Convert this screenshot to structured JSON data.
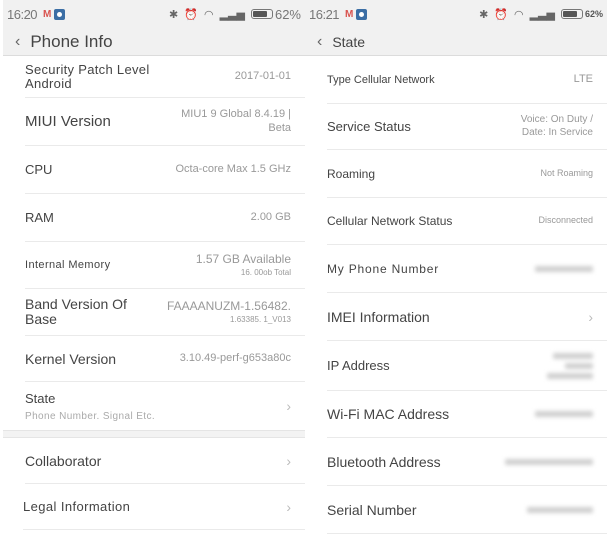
{
  "left": {
    "status": {
      "time": "16:20",
      "mail_icon": "M",
      "battery_pct": "62%",
      "battery_level": 0.62
    },
    "title": "Phone Info",
    "back_icon": "‹",
    "rows": [
      {
        "label": "Security Patch Level Android",
        "value": "2017-01-01"
      },
      {
        "label": "MIUI Version",
        "value": "MIU1 9 Global 8.4.19 |",
        "value2": "Beta"
      },
      {
        "label": "CPU",
        "value": "Octa-core Max 1.5 GHz"
      },
      {
        "label": "RAM",
        "value": "2.00 GB"
      },
      {
        "label": "Internal Memory",
        "value": "1.57 GB Available",
        "value2": "16. 00ob Total"
      },
      {
        "label": "Band Version Of Base",
        "value": "FAAAANUZM-1.56482.",
        "value2": "1.63385. 1_V013"
      },
      {
        "label": "Kernel Version",
        "value": "3.10.49-perf-g653a80c"
      },
      {
        "label": "State",
        "sublabel": "Phone Number. Signal Etc."
      }
    ],
    "rows2": [
      {
        "label": "Collaborator"
      },
      {
        "label": "Legal Information"
      }
    ],
    "chevron": "›"
  },
  "right": {
    "status": {
      "time": "16:21",
      "mail_icon": "M",
      "battery_pct": "62%",
      "battery_level": 0.62
    },
    "title": "State",
    "back_icon": "‹",
    "rows": [
      {
        "label": "Type Cellular Network",
        "value": "LTE"
      },
      {
        "label": "Service Status",
        "value": "Voice: On Duty /",
        "value2": "Date: In Service"
      },
      {
        "label": "Roaming",
        "value": "Not Roaming"
      },
      {
        "label": "Cellular Network Status",
        "value": "Disconnected"
      },
      {
        "label": "My Phone Number",
        "value": "[blurred]"
      },
      {
        "label": "IMEI Information"
      },
      {
        "label": "IP Address",
        "value": "[blurred]"
      },
      {
        "label": "Wi-Fi MAC Address",
        "value": "[blurred]"
      },
      {
        "label": "Bluetooth Address",
        "value": "[blurred]"
      },
      {
        "label": "Serial Number",
        "value": "[blurred]"
      }
    ],
    "chevron": "›"
  }
}
